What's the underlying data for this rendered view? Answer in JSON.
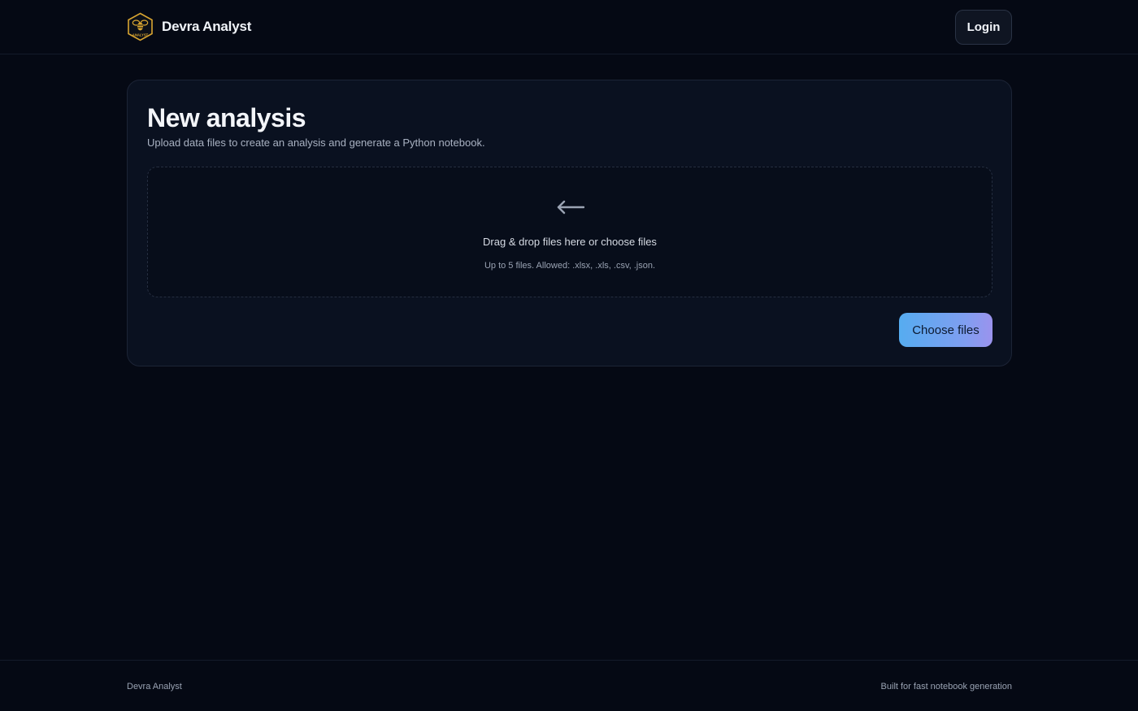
{
  "header": {
    "brand_name": "Devra Analyst",
    "logo_text": "ANALYST",
    "login_label": "Login"
  },
  "card": {
    "title": "New analysis",
    "subtitle": "Upload data files to create an analysis and generate a Python notebook.",
    "dropzone": {
      "icon": "arrow-left-icon",
      "text": "Drag & drop files here or choose files",
      "hint": "Up to 5 files. Allowed: .xlsx, .xls, .csv, .json."
    },
    "choose_label": "Choose files"
  },
  "footer": {
    "left": "Devra Analyst",
    "right": "Built for fast notebook generation"
  },
  "colors": {
    "background": "#050914",
    "card": "#0a1120",
    "accent_start": "#56acf0",
    "accent_end": "#9b93ee",
    "logo_gold": "#d9a531"
  }
}
